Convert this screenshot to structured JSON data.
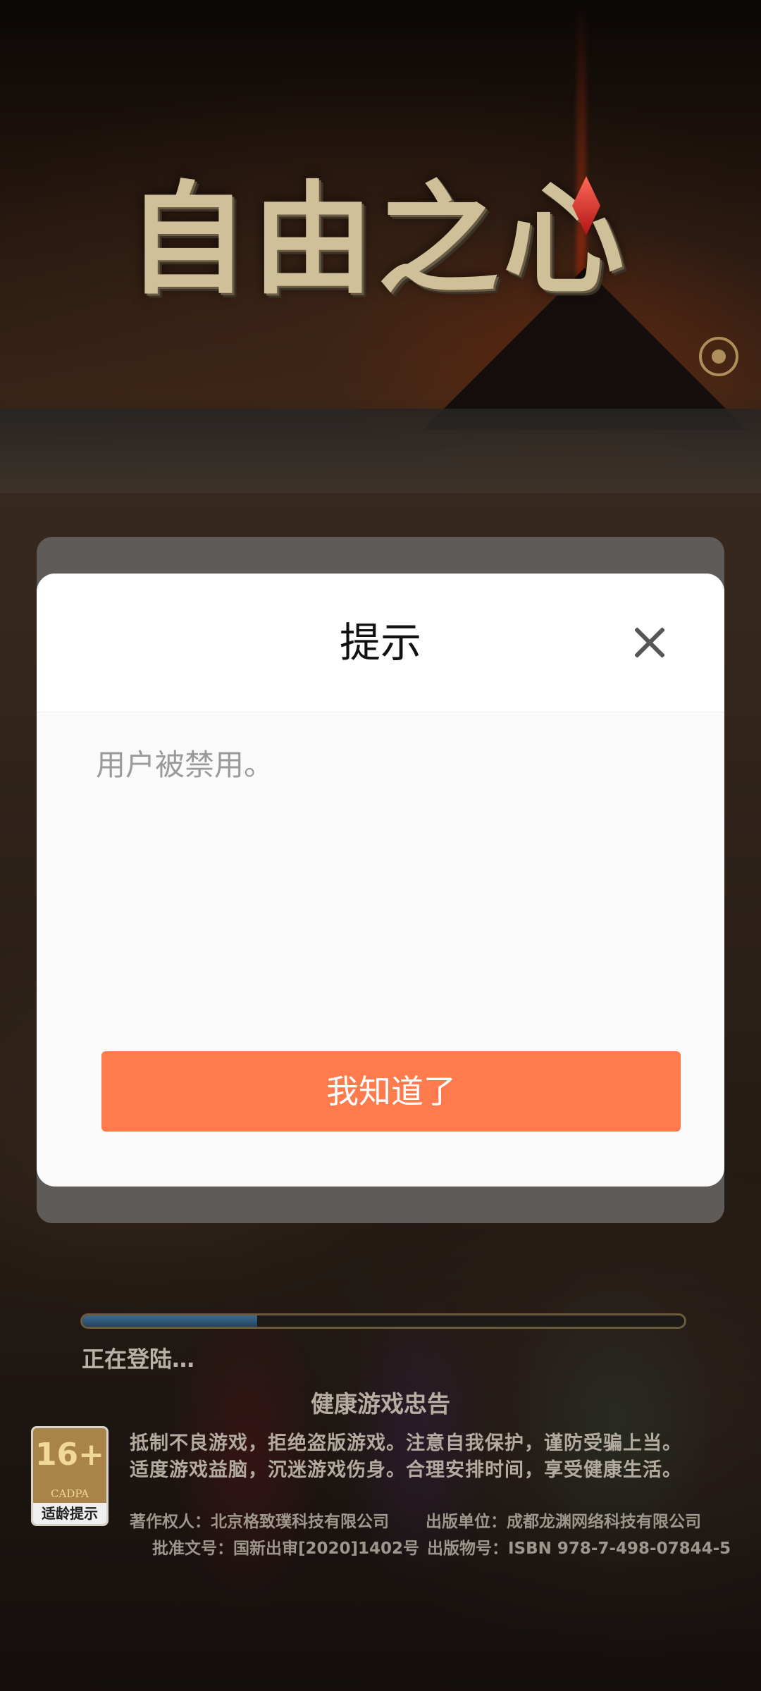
{
  "game": {
    "logo_text": "自由之心"
  },
  "dialog": {
    "title": "提示",
    "message": "用户被禁用。",
    "confirm_label": "我知道了"
  },
  "loading": {
    "status": "正在登陆…",
    "progress": 0.29
  },
  "advisory": {
    "title": "健康游戏忠告",
    "line1": "抵制不良游戏，拒绝盗版游戏。注意自我保护，谨防受骗上当。",
    "line2": "适度游戏益脑，沉迷游戏伤身。合理安排时间，享受健康生活。"
  },
  "age_rating": {
    "number": "16+",
    "org": "CADPA",
    "label": "适龄提示"
  },
  "legal": {
    "copyright": "著作权人：北京格致璞科技有限公司",
    "publisher": "出版单位：成都龙渊网络科技有限公司",
    "approval": "批准文号：国新出审[2020]1402号",
    "isbn": "出版物号：ISBN 978-7-498-07844-5"
  },
  "icons": {
    "close": "close-icon",
    "eye": "eye-icon"
  },
  "colors": {
    "accent": "#ff7a4c"
  }
}
